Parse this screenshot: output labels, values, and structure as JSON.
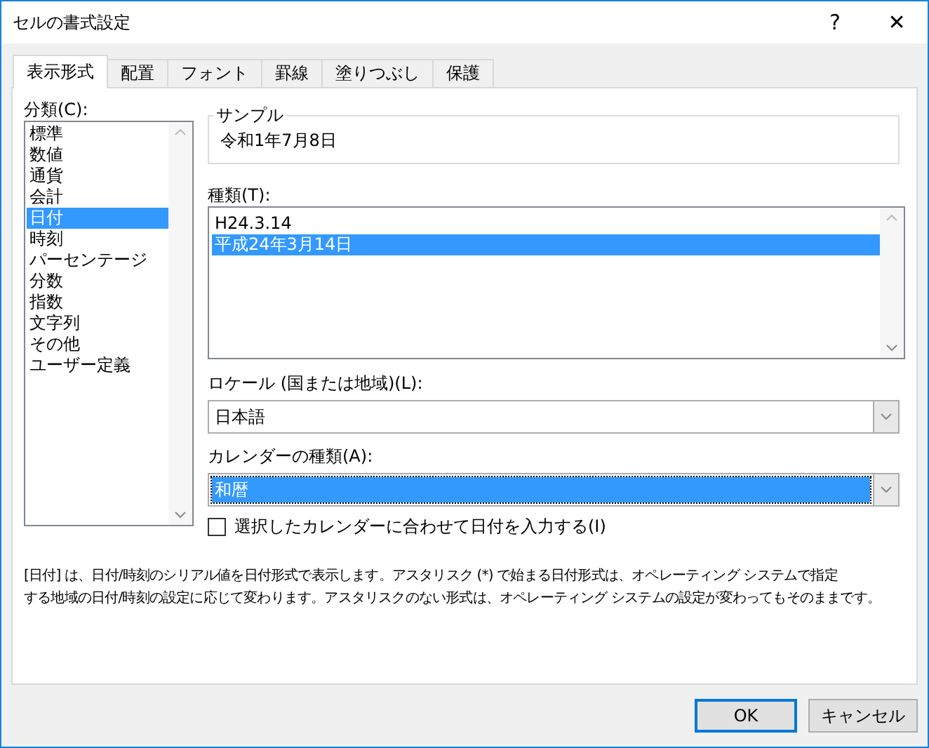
{
  "window": {
    "title": "セルの書式設定",
    "help": "?",
    "close": "✕"
  },
  "tabs": [
    {
      "label": "表示形式",
      "selected": true
    },
    {
      "label": "配置",
      "selected": false
    },
    {
      "label": "フォント",
      "selected": false
    },
    {
      "label": "罫線",
      "selected": false
    },
    {
      "label": "塗りつぶし",
      "selected": false
    },
    {
      "label": "保護",
      "selected": false
    }
  ],
  "category": {
    "label": "分類(C):",
    "items": [
      {
        "label": "標準",
        "selected": false
      },
      {
        "label": "数値",
        "selected": false
      },
      {
        "label": "通貨",
        "selected": false
      },
      {
        "label": "会計",
        "selected": false
      },
      {
        "label": "日付",
        "selected": true
      },
      {
        "label": "時刻",
        "selected": false
      },
      {
        "label": "パーセンテージ",
        "selected": false
      },
      {
        "label": "分数",
        "selected": false
      },
      {
        "label": "指数",
        "selected": false
      },
      {
        "label": "文字列",
        "selected": false
      },
      {
        "label": "その他",
        "selected": false
      },
      {
        "label": "ユーザー定義",
        "selected": false
      }
    ]
  },
  "sample": {
    "label": "サンプル",
    "value": "令和1年7月8日"
  },
  "type": {
    "label": "種類(T):",
    "items": [
      {
        "label": "H24.3.14",
        "selected": false
      },
      {
        "label": "平成24年3月14日",
        "selected": true
      }
    ]
  },
  "locale": {
    "label": "ロケール (国または地域)(L):",
    "value": "日本語",
    "highlighted": false
  },
  "calendar": {
    "label": "カレンダーの種類(A):",
    "value": "和暦",
    "highlighted": true
  },
  "match_calendar": {
    "label": "選択したカレンダーに合わせて日付を入力する(I)",
    "checked": false
  },
  "description_lines": [
    "[日付] は、日付/時刻のシリアル値を日付形式で表示します。アスタリスク (*) で始まる日付形式は、オペレーティング システムで指定",
    "する地域の日付/時刻の設定に応じて変わります。アスタリスクのない形式は、オペレーティング システムの設定が変わってもそのままです。"
  ],
  "buttons": [
    {
      "label": "OK",
      "default": true
    },
    {
      "label": "キャンセル",
      "default": false
    }
  ]
}
